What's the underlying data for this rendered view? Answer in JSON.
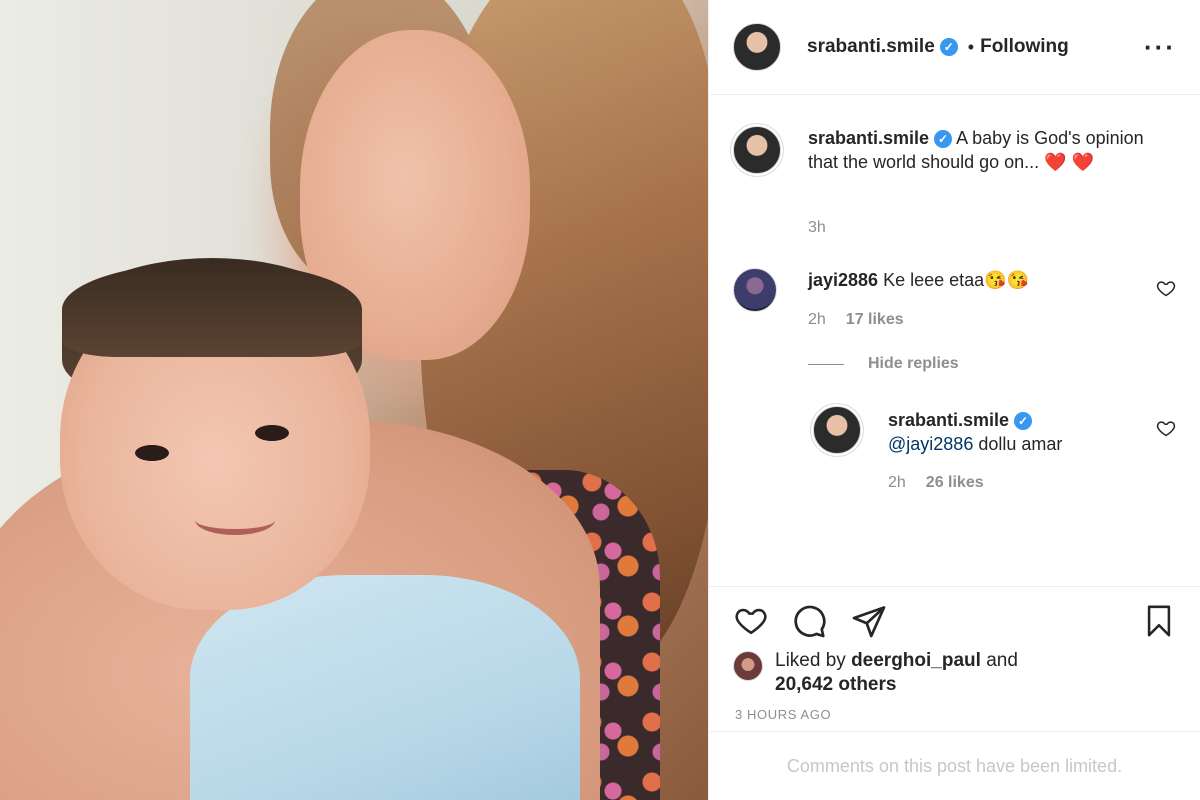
{
  "post": {
    "author": "srabanti.smile",
    "follow_status": "Following",
    "follow_separator": "•",
    "more_icon": "ellipsis-icon",
    "caption_author": "srabanti.smile",
    "caption": "A baby is God's opinion that the world should go on... ❤️ ❤️",
    "caption_time": "3h"
  },
  "comments": [
    {
      "author": "jayi2886",
      "text": "Ke leee etaa😘😘",
      "time": "2h",
      "likes": "17 likes"
    }
  ],
  "hide_replies": "Hide replies",
  "replies": [
    {
      "author": "srabanti.smile",
      "mention": "@jayi2886",
      "text": " dollu amar",
      "time": "2h",
      "likes": "26 likes"
    }
  ],
  "actions": {
    "icons": [
      "heart-icon",
      "comment-icon",
      "share-icon",
      "bookmark-icon"
    ],
    "liked_prefix": "Liked by",
    "liked_by": "deerghoi_paul",
    "liked_and": "and",
    "others": "20,642 others",
    "timestamp": "3 HOURS AGO"
  },
  "footer": {
    "limited_text": "Comments on this post have been limited."
  },
  "colors": {
    "verified": "#3897f0",
    "muted": "#8e8e8e",
    "text": "#262626",
    "mention": "#003569",
    "divider": "#efefef"
  }
}
